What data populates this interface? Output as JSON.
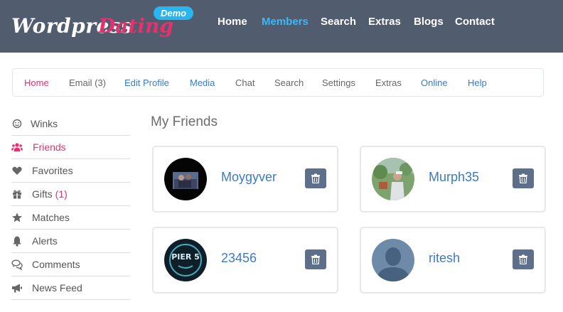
{
  "brand": {
    "logo_word": "Wordpress",
    "logo_accent": "Dating",
    "badge": "Demo"
  },
  "topnav": [
    {
      "label": "Home",
      "active": false
    },
    {
      "label": "Members",
      "active": true
    },
    {
      "label": "Search",
      "active": false
    },
    {
      "label": "Extras",
      "active": false
    },
    {
      "label": "Blogs",
      "active": false
    },
    {
      "label": "Contact",
      "active": false
    }
  ],
  "subnav": [
    {
      "label": "Home"
    },
    {
      "label": "Email (3)"
    },
    {
      "label": "Edit Profile"
    },
    {
      "label": "Media"
    },
    {
      "label": "Chat"
    },
    {
      "label": "Search"
    },
    {
      "label": "Settings"
    },
    {
      "label": "Extras"
    },
    {
      "label": "Online"
    },
    {
      "label": "Help"
    }
  ],
  "sidebar": [
    {
      "label": "Winks",
      "icon": "smiley-icon"
    },
    {
      "label": "Friends",
      "icon": "users-icon",
      "active": true
    },
    {
      "label": "Favorites",
      "icon": "heart-icon"
    },
    {
      "label": "Gifts",
      "count": "(1)",
      "icon": "gift-icon"
    },
    {
      "label": "Matches",
      "icon": "star-icon"
    },
    {
      "label": "Alerts",
      "icon": "bell-icon"
    },
    {
      "label": "Comments",
      "icon": "comments-icon"
    },
    {
      "label": "News Feed",
      "icon": "bullhorn-icon"
    }
  ],
  "main": {
    "title": "My Friends",
    "friends": [
      {
        "name": "Moygyver"
      },
      {
        "name": "Murph35"
      },
      {
        "name": "23456",
        "avatar_text": "PIER 5"
      },
      {
        "name": "ritesh"
      }
    ]
  },
  "colors": {
    "header_bg": "#515c6e",
    "accent_pink": "#e8306d",
    "active_blue": "#3fb6f5",
    "link_blue": "#3a7bc8",
    "button_slate": "#5d6f8a"
  }
}
